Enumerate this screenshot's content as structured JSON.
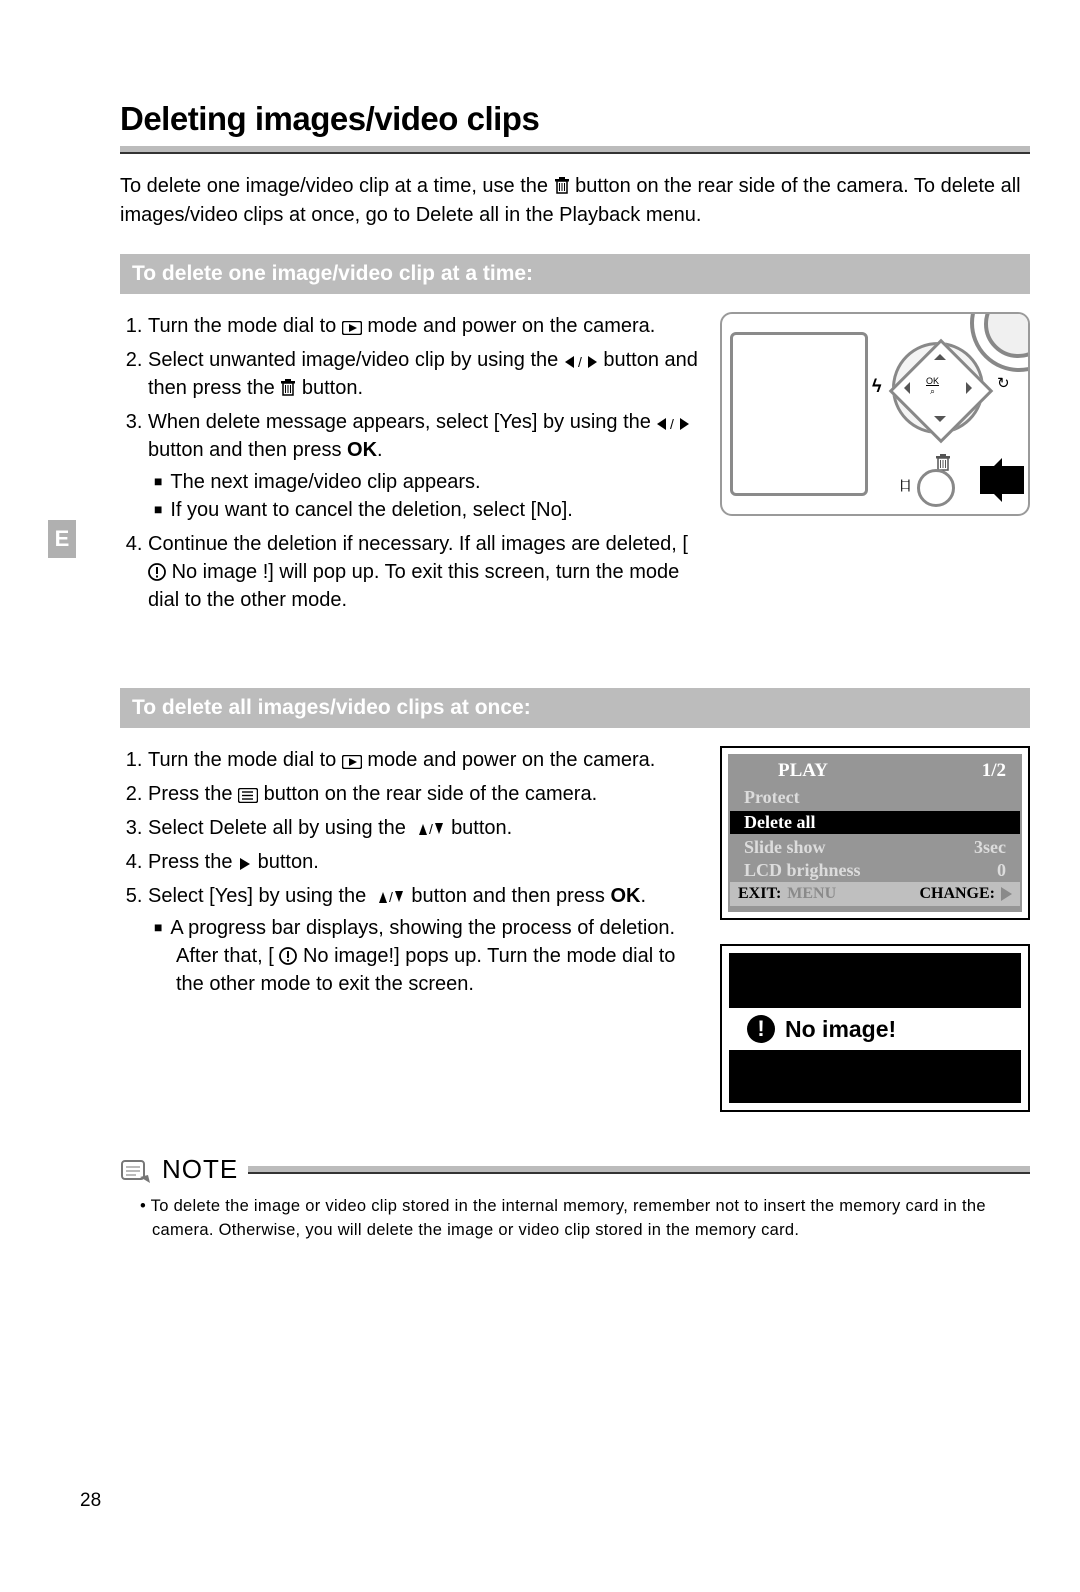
{
  "sideTab": "E",
  "pageNumber": "28",
  "title": "Deleting images/video clips",
  "intro": {
    "t1": "To delete one image/video clip at a time, use the ",
    "t2": " button on the rear side of the camera. To delete all images/video clips at once, go to Delete all in the Playback menu."
  },
  "sectionA": {
    "heading": "To delete one image/video clip at a time:",
    "s1a": "Turn the mode dial to ",
    "s1b": " mode and power on the camera.",
    "s2a": "Select unwanted image/video clip by using the ",
    "s2b": " button and then press the ",
    "s2c": " button.",
    "s3a": "When delete message appears, select [Yes] by using the ",
    "s3b": " button and then press ",
    "s3ok": "OK",
    "s3c": ".",
    "b1": "The next image/video clip appears.",
    "b2": "If you want to cancel the deletion, select [No].",
    "s4a": "Continue the deletion if necessary. If all images are deleted, [",
    "s4b": " No image !] will pop up. To exit this screen, turn the mode dial to the other mode."
  },
  "sectionB": {
    "heading": "To delete all images/video clips at once:",
    "s1a": "Turn the mode dial to ",
    "s1b": " mode and power on the camera.",
    "s2a": "Press the ",
    "s2b": " button on the rear side of the camera.",
    "s3a": "Select Delete all by using the ",
    "s3b": " button.",
    "s4a": "Press the ",
    "s4b": " button.",
    "s5a": "Select [Yes] by using the ",
    "s5b": " button and then press ",
    "s5ok": "OK",
    "s5c": ".",
    "b1a": "A progress bar displays, showing the process of deletion. After that, [",
    "b1b": " No image!] pops up. Turn the mode dial to the other mode to exit the screen."
  },
  "lcdMenu": {
    "title": "PLAY",
    "page": "1/2",
    "r1": "Protect",
    "r2": "Delete all",
    "r3": "Slide show",
    "r3v": "3sec",
    "r4": "LCD brighness",
    "r4v": "0",
    "exit": "EXIT:",
    "menu": "MENU",
    "change": "CHANGE:"
  },
  "noImage": {
    "text": "No image!"
  },
  "note": {
    "label": "NOTE",
    "text": "• To delete the image or video clip stored in the internal memory, remember not to insert the memory card in the camera. Otherwise, you will delete the image or video clip stored in the memory card."
  },
  "cameraLabels": {
    "ok": "OK",
    "mag": "⌕"
  }
}
